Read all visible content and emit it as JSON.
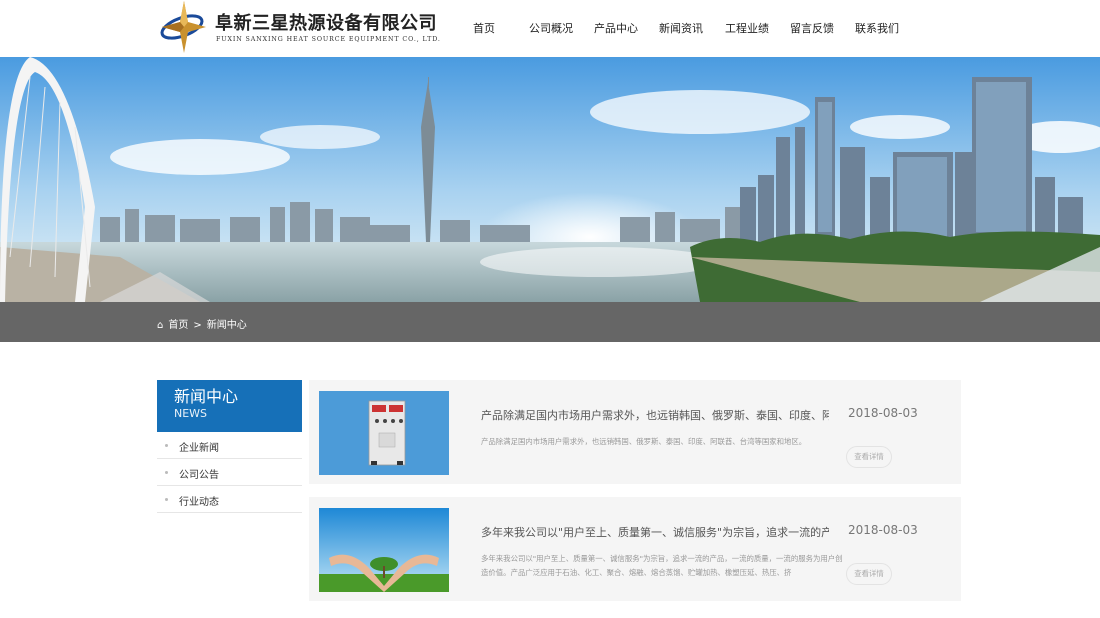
{
  "header": {
    "company_cn": "阜新三星热源设备有限公司",
    "company_en": "FUXIN SANXING HEAT SOURCE EQUIPMENT CO., LTD.",
    "nav": [
      "首页",
      "公司概况",
      "产品中心",
      "新闻资讯",
      "工程业绩",
      "留言反馈",
      "联系我们"
    ]
  },
  "breadcrumb": {
    "home": "首页",
    "separator": ">",
    "current": "新闻中心"
  },
  "sidebar": {
    "title": "新闻中心",
    "subtitle": "NEWS",
    "items": [
      "企业新闻",
      "公司公告",
      "行业动态"
    ]
  },
  "news": [
    {
      "title": "产品除满足国内市场用户需求外，也远销韩国、俄罗斯、泰国、印度、阿联",
      "date": "2018-08-03",
      "desc": "产品除满足国内市场用户需求外，也远销韩国、俄罗斯、泰国、印度、阿联酋、台湾等国家和地区。",
      "button": "查看详情"
    },
    {
      "title": "多年来我公司以\"用户至上、质量第一、诚信服务\"为宗旨，追求一流的产品",
      "date": "2018-08-03",
      "desc": "多年来我公司以\"用户至上、质量第一、诚信服务\"为宗旨，追求一流的产品，一流的质量，一流的服务为用户创造价值。产品广泛应用于石油、化工、聚合、熔融、熔合蒸馏、贮罐加热、橡塑压延、热压、挤",
      "button": "查看详情"
    }
  ],
  "colors": {
    "accent": "#1670b8",
    "breadcrumb_bg": "#666666"
  }
}
